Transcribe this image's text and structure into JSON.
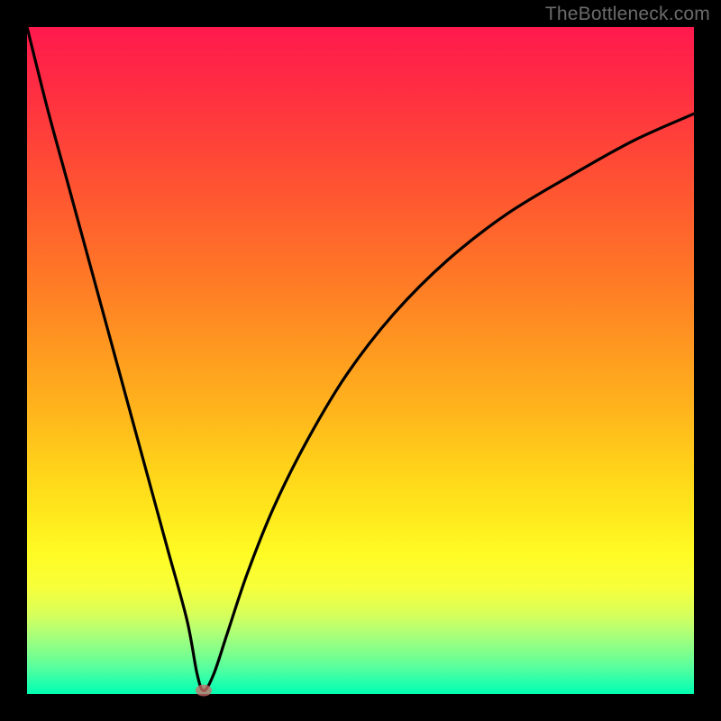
{
  "watermark": "TheBottleneck.com",
  "colors": {
    "frame": "#000000",
    "curve": "#000000",
    "marker": "#d66a6a",
    "gradient_top": "#ff1a4d",
    "gradient_bottom": "#00ffb0"
  },
  "chart_data": {
    "type": "line",
    "title": "",
    "xlabel": "",
    "ylabel": "",
    "xlim": [
      0,
      100
    ],
    "ylim": [
      0,
      100
    ],
    "grid": false,
    "legend": false,
    "note": "No axis ticks or labels are visible; x/y values are estimated as percentages of the plot area (0=left/bottom, 100=right/top).",
    "series": [
      {
        "name": "curve",
        "x": [
          0,
          3,
          6,
          9,
          12,
          15,
          18,
          21,
          24,
          25.5,
          26.5,
          28,
          30,
          33,
          37,
          42,
          48,
          55,
          63,
          72,
          82,
          91,
          100
        ],
        "y": [
          100,
          88,
          77,
          66,
          55,
          44,
          33,
          22,
          11,
          3,
          0.5,
          3,
          9,
          18,
          28,
          38,
          48,
          57,
          65,
          72,
          78,
          83,
          87
        ]
      }
    ],
    "annotations": [
      {
        "name": "min-marker",
        "x": 26.5,
        "y": 0.5
      }
    ]
  }
}
